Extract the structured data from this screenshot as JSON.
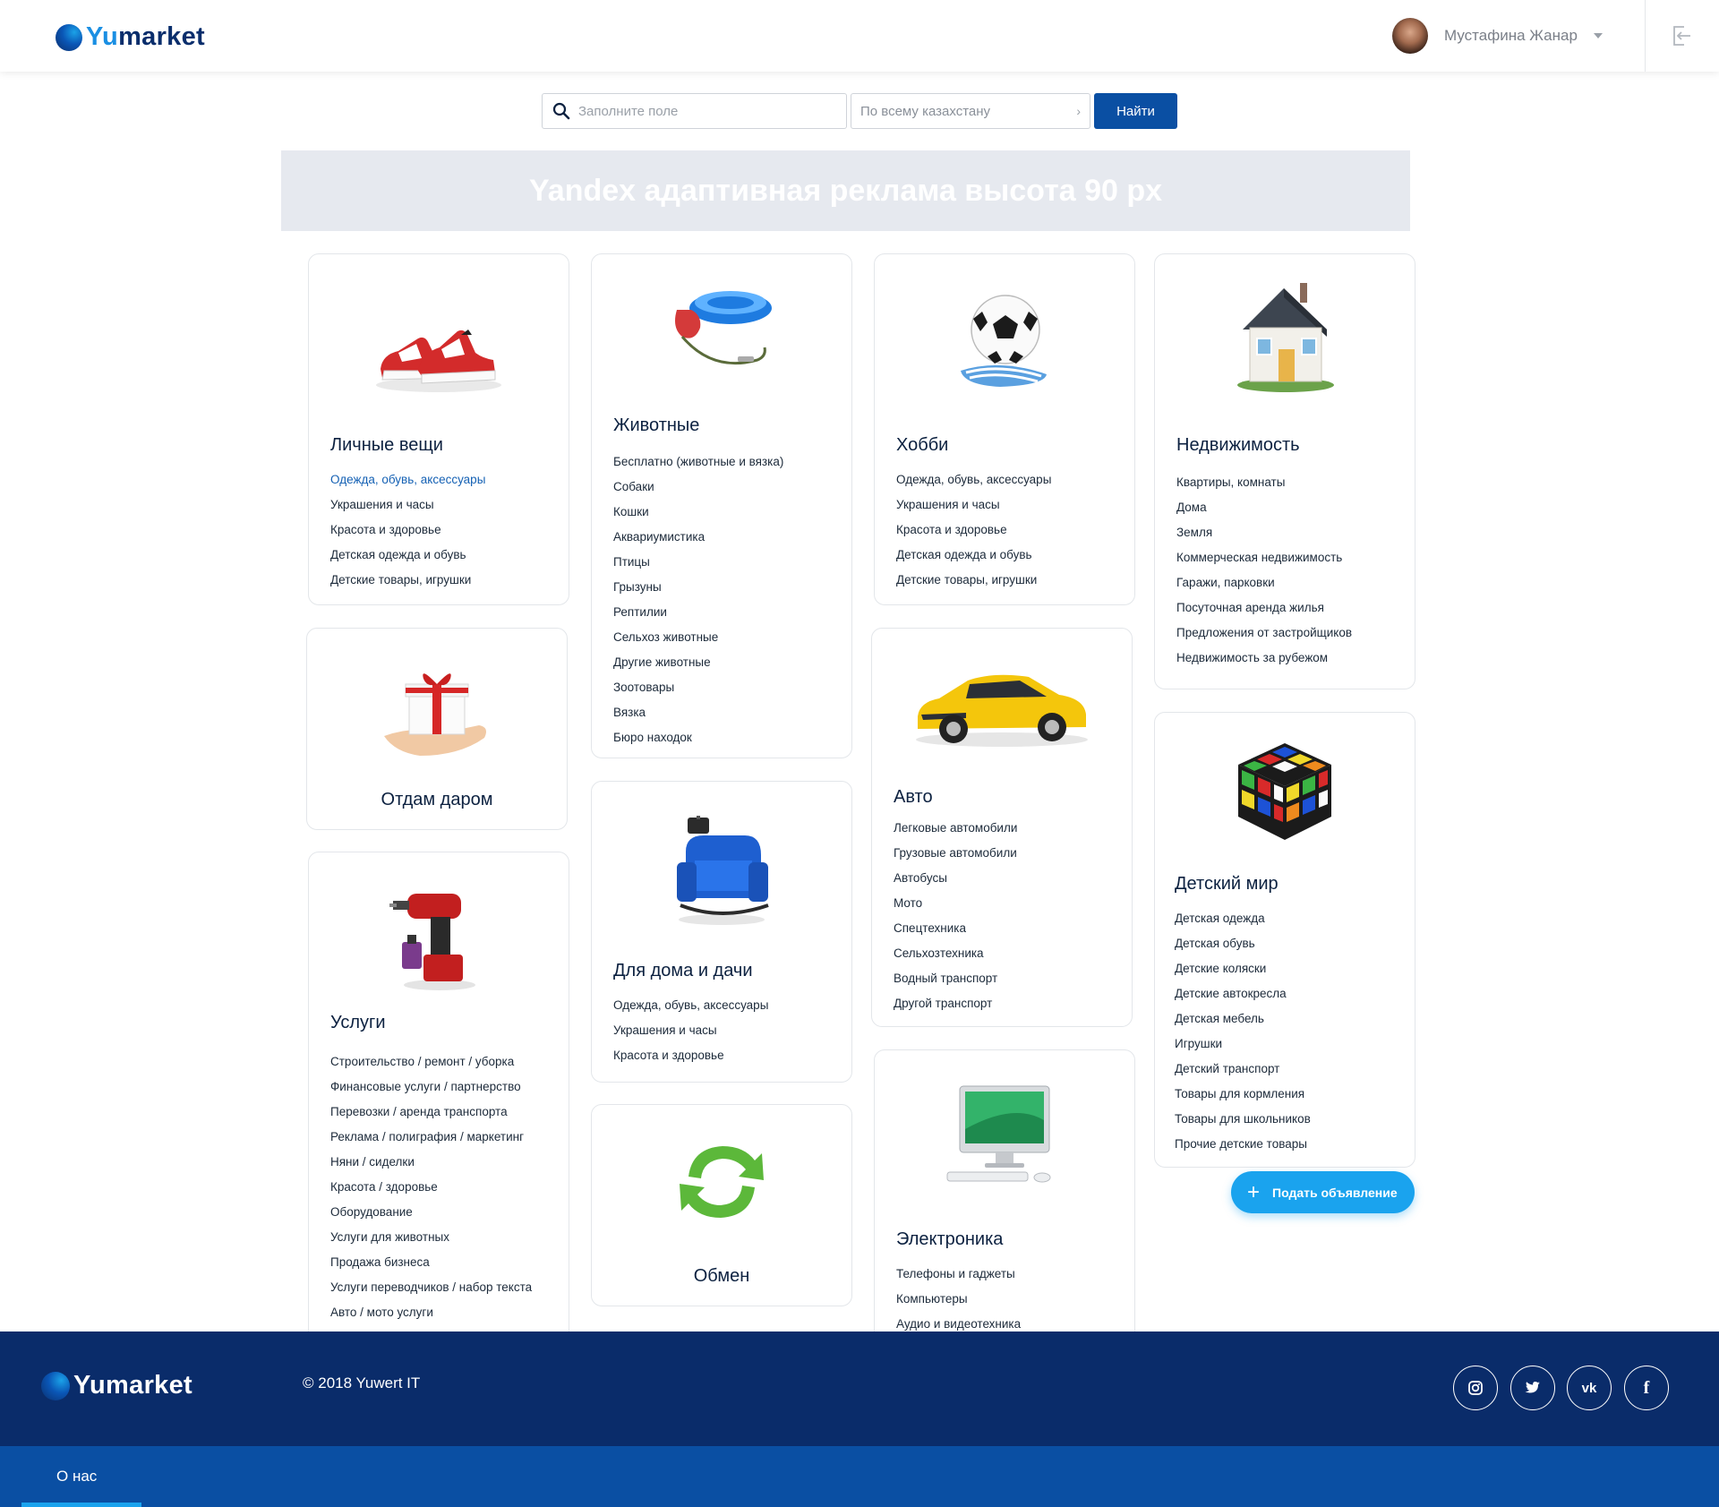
{
  "header": {
    "logo_prefix": "Yu",
    "logo_suffix": "market",
    "user_name": "Мустафина Жанар"
  },
  "search": {
    "placeholder": "Заполните поле",
    "region": "По всему казахстану",
    "button": "Найти"
  },
  "ad_banner": "Yandex адаптивная реклама высота 90 px",
  "categories": {
    "personal": {
      "title": "Личные вещи",
      "items": [
        "Одежда, обувь, аксессуары",
        "Украшения и часы",
        "Красота и здоровье",
        "Детская одежда и обувь",
        "Детские товары, игрушки"
      ]
    },
    "animals": {
      "title": "Животные",
      "items": [
        "Бесплатно (животные и вязка)",
        "Собаки",
        "Кошки",
        "Аквариумистика",
        "Птицы",
        "Грызуны",
        "Рептилии",
        "Сельхоз животные",
        "Другие животные",
        "Зоотовары",
        "Вязка",
        "Бюро находок"
      ]
    },
    "hobby": {
      "title": "Хобби",
      "items": [
        "Одежда, обувь, аксессуары",
        "Украшения и часы",
        "Красота и здоровье",
        "Детская одежда и обувь",
        "Детские товары, игрушки"
      ]
    },
    "realty": {
      "title": "Недвижимость",
      "items": [
        "Квартиры, комнаты",
        "Дома",
        "Земля",
        "Коммерческая недвижимость",
        "Гаражи, парковки",
        "Посуточная аренда жилья",
        "Предложения от застройщиков",
        "Недвижимость за рубежом"
      ]
    },
    "giveaway": {
      "title": "Отдам даром"
    },
    "auto": {
      "title": "Авто",
      "items": [
        "Легковые автомобили",
        "Грузовые автомобили",
        "Автобусы",
        "Мото",
        "Спецтехника",
        "Сельхозтехника",
        "Водный транспорт",
        "Другой транспорт"
      ]
    },
    "kids": {
      "title": "Детский мир",
      "items": [
        "Детская одежда",
        "Детская обувь",
        "Детские коляски",
        "Детские автокресла",
        "Детская мебель",
        "Игрушки",
        "Детский транспорт",
        "Товары для кормления",
        "Товары для школьников",
        "Прочие детские товары"
      ]
    },
    "services": {
      "title": "Услуги",
      "items": [
        "Строительство / ремонт / уборка",
        "Финансовые услуги / партнерство",
        "Перевозки / аренда транспорта",
        "Реклама / полиграфия / маркетинг",
        "Няни / сиделки",
        "Красота / здоровье",
        "Оборудование",
        "Услуги для животных",
        "Продажа бизнеса",
        "Услуги переводчиков / набор текста",
        "Авто / мото услуги"
      ]
    },
    "home": {
      "title": "Для дома и дачи",
      "items": [
        "Одежда, обувь, аксессуары",
        "Украшения и часы",
        "Красота и здоровье"
      ]
    },
    "exchange": {
      "title": "Обмен"
    },
    "electronics": {
      "title": "Электроника",
      "items": [
        "Телефоны и гаджеты",
        "Компьютеры",
        "Аудио и видеотехника"
      ]
    }
  },
  "fab_label": "Подать объявление",
  "footer": {
    "logo": "Yumarket",
    "copyright": "© 2018 Yuwert IT",
    "social": [
      "instagram-icon",
      "twitter-icon",
      "vk-icon",
      "facebook-icon"
    ],
    "about": "О нас"
  },
  "colors": {
    "brand_dark": "#0a2c6a",
    "brand_blue": "#0a4fa3",
    "accent": "#1aa3ee",
    "active_link": "#1561b4"
  }
}
